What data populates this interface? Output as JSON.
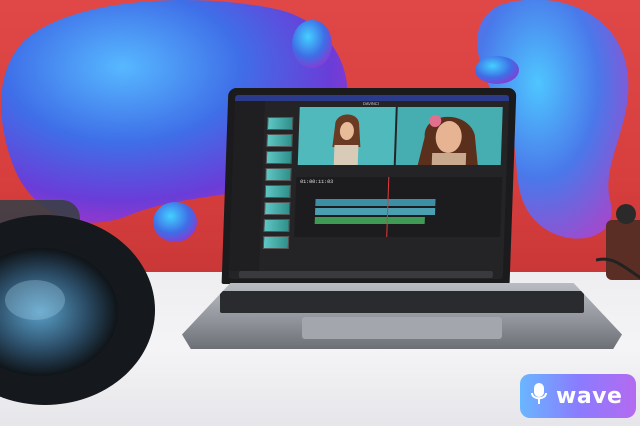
{
  "scene": {
    "description_colors": {
      "wall": "#d73e3e",
      "blob_blue": "#3b6cf0",
      "blob_purple": "#8a39d8",
      "desk": "#eeeef0",
      "laptop_silver": "#a3a6ad",
      "editor_dark": "#242427"
    }
  },
  "screen": {
    "app_title": "DAVINCI",
    "timecode": "01:00:11:03"
  },
  "watermark": {
    "brand": "wave",
    "icon": "microphone-icon"
  }
}
